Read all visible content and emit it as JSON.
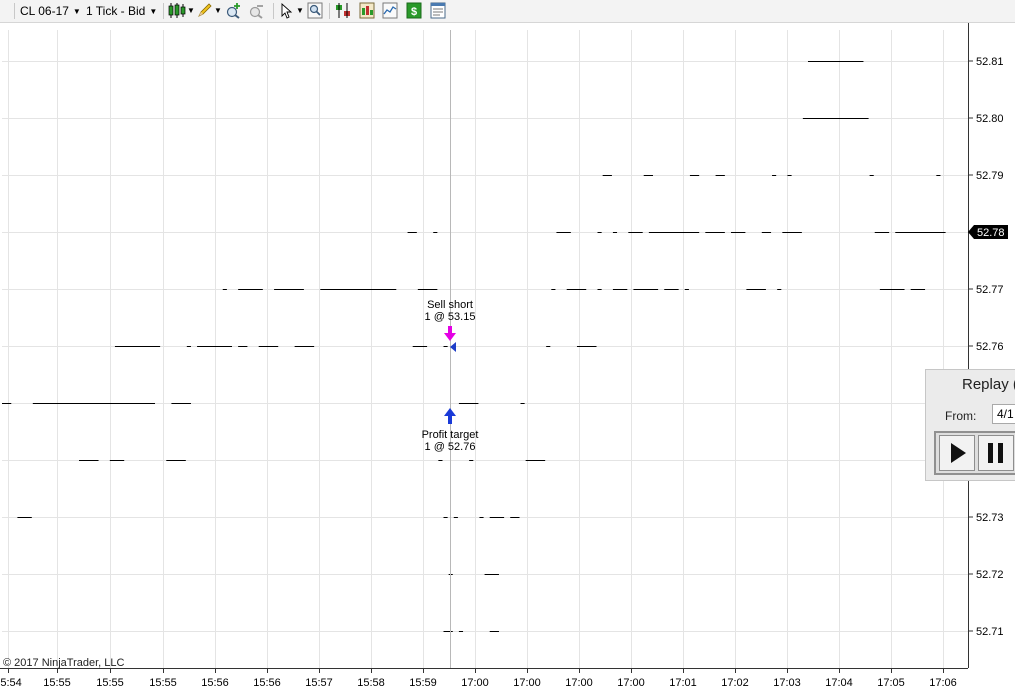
{
  "toolbar": {
    "instrument": "CL 06-17",
    "interval": "1 Tick - Bid",
    "icons": [
      "candlestick-style-icon",
      "pencil-draw-icon",
      "zoom-in-icon",
      "zoom-out-icon",
      "pointer-cursor-icon",
      "magnifier-icon",
      "strategies-icon",
      "chart-trader-icon",
      "indicators-icon",
      "dollar-icon",
      "properties-icon"
    ]
  },
  "chart_data": {
    "type": "line",
    "title": "",
    "xlabel": "",
    "ylabel": "",
    "ylim": [
      52.705,
      52.815
    ],
    "grid": true,
    "y_ticks": [
      "52.71",
      "52.72",
      "52.73",
      "52.74",
      "52.75",
      "52.76",
      "52.77",
      "52.78",
      "52.79",
      "52.80",
      "52.81"
    ],
    "y_tick_labels_visible": [
      "52.71",
      "52.72",
      "52.73",
      "52.76",
      "52.77",
      "52.79",
      "52.80",
      "52.81"
    ],
    "x_tick_labels": [
      "15:54",
      "15:55",
      "15:55",
      "15:55",
      "15:56",
      "15:56",
      "15:57",
      "15:58",
      "15:59",
      "17:00",
      "17:00",
      "17:00",
      "17:00",
      "17:01",
      "17:02",
      "17:03",
      "17:04",
      "17:05",
      "17:06"
    ],
    "last_price": "52.78",
    "series": [
      {
        "values": [
          {
            "price": 52.75,
            "from": 0,
            "to": 2
          },
          {
            "price": 52.75,
            "from": 6,
            "to": 30
          },
          {
            "price": 52.75,
            "from": 33,
            "to": 37
          },
          {
            "price": 52.73,
            "from": 3,
            "to": 6
          },
          {
            "price": 52.74,
            "from": 15,
            "to": 19
          },
          {
            "price": 52.74,
            "from": 21,
            "to": 24
          },
          {
            "price": 52.74,
            "from": 32,
            "to": 36
          },
          {
            "price": 52.76,
            "from": 22,
            "to": 31
          },
          {
            "price": 52.76,
            "from": 36,
            "to": 37
          },
          {
            "price": 52.76,
            "from": 38,
            "to": 45
          },
          {
            "price": 52.76,
            "from": 46,
            "to": 48
          },
          {
            "price": 52.76,
            "from": 50,
            "to": 54
          },
          {
            "price": 52.76,
            "from": 57,
            "to": 61
          },
          {
            "price": 52.77,
            "from": 43,
            "to": 44
          },
          {
            "price": 52.77,
            "from": 46,
            "to": 51
          },
          {
            "price": 52.77,
            "from": 53,
            "to": 59
          },
          {
            "price": 52.77,
            "from": 62,
            "to": 77
          },
          {
            "price": 52.77,
            "from": 81,
            "to": 85
          },
          {
            "price": 52.78,
            "from": 79,
            "to": 81
          },
          {
            "price": 52.78,
            "from": 84,
            "to": 85
          },
          {
            "price": 52.76,
            "from": 80,
            "to": 83
          },
          {
            "price": 52.76,
            "from": 86,
            "to": 87
          },
          {
            "price": 52.74,
            "from": 85,
            "to": 86
          },
          {
            "price": 52.74,
            "from": 91,
            "to": 92
          },
          {
            "price": 52.73,
            "from": 86,
            "to": 87
          },
          {
            "price": 52.73,
            "from": 88,
            "to": 89
          },
          {
            "price": 52.73,
            "from": 93,
            "to": 94
          },
          {
            "price": 52.73,
            "from": 95,
            "to": 98
          },
          {
            "price": 52.73,
            "from": 99,
            "to": 101
          },
          {
            "price": 52.75,
            "from": 89,
            "to": 93
          },
          {
            "price": 52.75,
            "from": 101,
            "to": 102
          },
          {
            "price": 52.72,
            "from": 87,
            "to": 88
          },
          {
            "price": 52.72,
            "from": 94,
            "to": 97
          },
          {
            "price": 52.71,
            "from": 86,
            "to": 88
          },
          {
            "price": 52.71,
            "from": 89,
            "to": 90
          },
          {
            "price": 52.71,
            "from": 95,
            "to": 97
          },
          {
            "price": 52.74,
            "from": 102,
            "to": 106
          },
          {
            "price": 52.76,
            "from": 106,
            "to": 107
          },
          {
            "price": 52.76,
            "from": 112,
            "to": 116
          },
          {
            "price": 52.77,
            "from": 107,
            "to": 108
          },
          {
            "price": 52.77,
            "from": 110,
            "to": 114
          },
          {
            "price": 52.77,
            "from": 116,
            "to": 117
          },
          {
            "price": 52.77,
            "from": 119,
            "to": 122
          },
          {
            "price": 52.77,
            "from": 123,
            "to": 128
          },
          {
            "price": 52.77,
            "from": 129,
            "to": 132
          },
          {
            "price": 52.77,
            "from": 133,
            "to": 134
          },
          {
            "price": 52.77,
            "from": 145,
            "to": 149
          },
          {
            "price": 52.77,
            "from": 151,
            "to": 152
          },
          {
            "price": 52.77,
            "from": 171,
            "to": 176
          },
          {
            "price": 52.77,
            "from": 177,
            "to": 180
          },
          {
            "price": 52.78,
            "from": 108,
            "to": 111
          },
          {
            "price": 52.78,
            "from": 116,
            "to": 117
          },
          {
            "price": 52.78,
            "from": 119,
            "to": 120
          },
          {
            "price": 52.78,
            "from": 122,
            "to": 125
          },
          {
            "price": 52.78,
            "from": 126,
            "to": 136
          },
          {
            "price": 52.78,
            "from": 137,
            "to": 141
          },
          {
            "price": 52.78,
            "from": 142,
            "to": 145
          },
          {
            "price": 52.78,
            "from": 148,
            "to": 150
          },
          {
            "price": 52.78,
            "from": 152,
            "to": 156
          },
          {
            "price": 52.78,
            "from": 170,
            "to": 173
          },
          {
            "price": 52.78,
            "from": 174,
            "to": 184
          },
          {
            "price": 52.79,
            "from": 117,
            "to": 119
          },
          {
            "price": 52.79,
            "from": 125,
            "to": 127
          },
          {
            "price": 52.79,
            "from": 134,
            "to": 136
          },
          {
            "price": 52.79,
            "from": 139,
            "to": 141
          },
          {
            "price": 52.79,
            "from": 150,
            "to": 151
          },
          {
            "price": 52.79,
            "from": 153,
            "to": 154
          },
          {
            "price": 52.79,
            "from": 169,
            "to": 170
          },
          {
            "price": 52.79,
            "from": 182,
            "to": 183
          },
          {
            "price": 52.8,
            "from": 156,
            "to": 169
          },
          {
            "price": 52.81,
            "from": 157,
            "to": 168
          }
        ]
      }
    ]
  },
  "orders": {
    "sell": {
      "line1": "Sell short",
      "line2": "1 @ 53.15"
    },
    "target": {
      "line1": "Profit target",
      "line2": "1 @ 52.76"
    }
  },
  "copyright": "© 2017 NinjaTrader, LLC",
  "replay": {
    "title": "Replay (",
    "from_label": "From:",
    "from_value": "4/1"
  }
}
